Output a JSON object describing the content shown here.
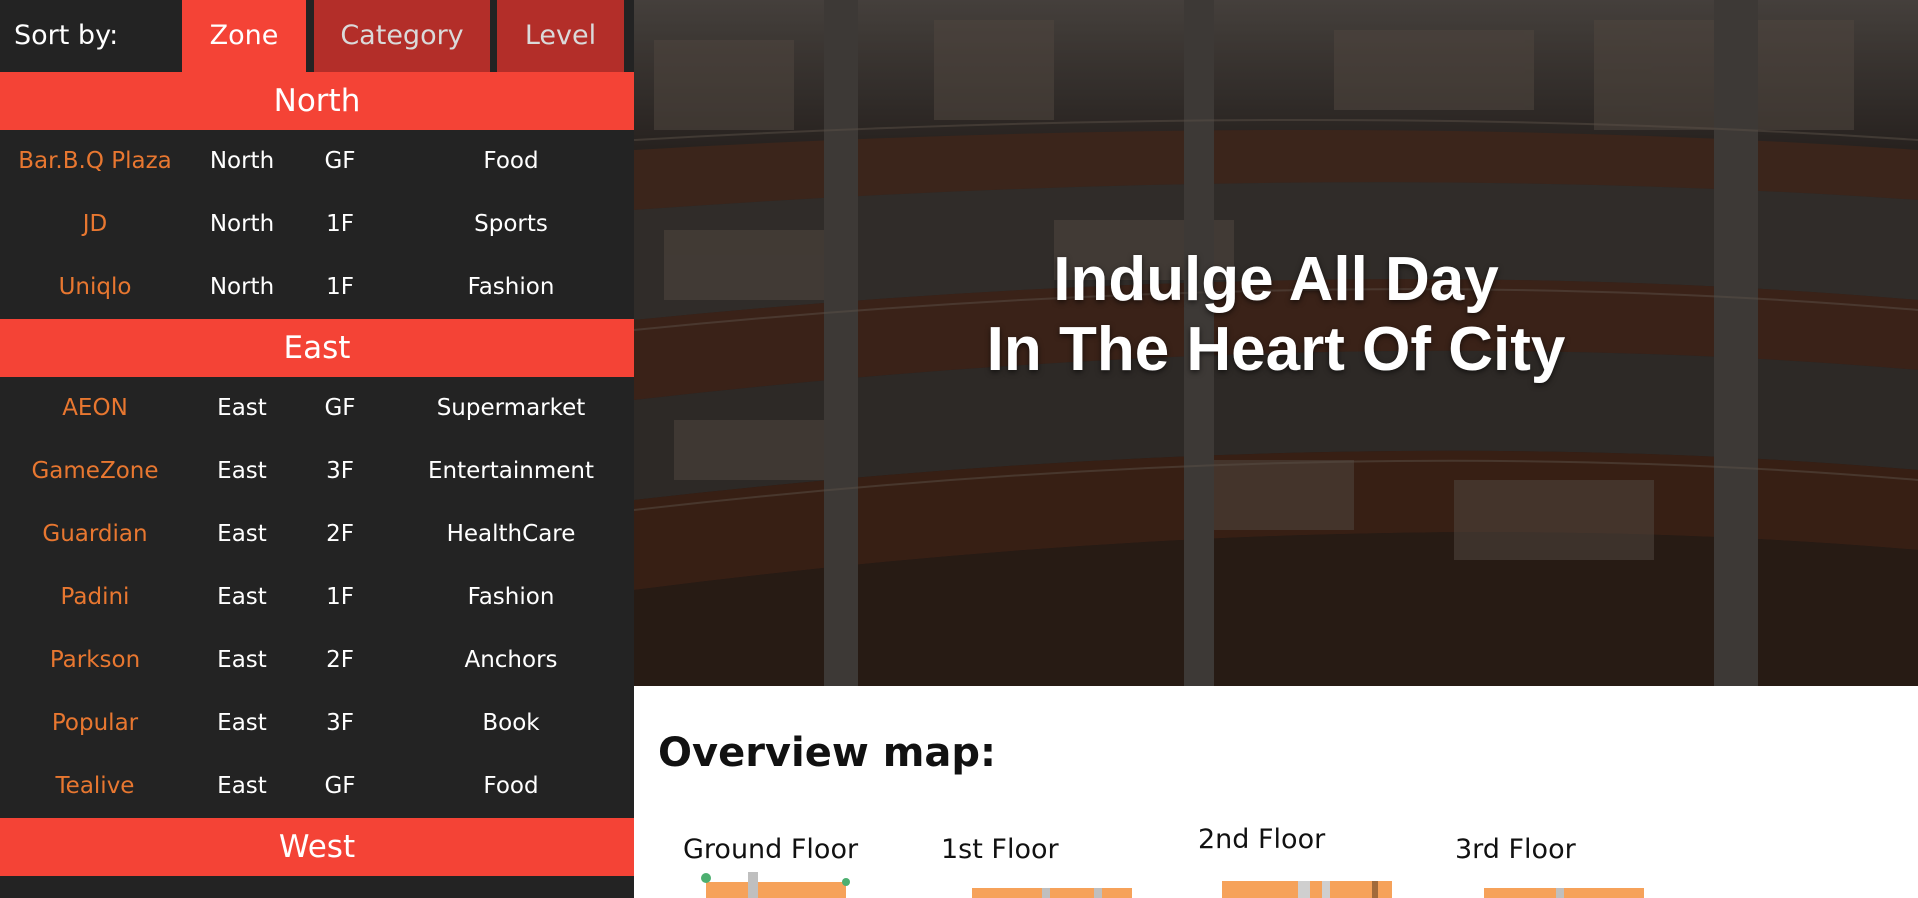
{
  "sort": {
    "label": "Sort by:",
    "tabs": [
      {
        "label": "Zone",
        "active": true
      },
      {
        "label": "Category",
        "active": false
      },
      {
        "label": "Level",
        "active": false
      }
    ]
  },
  "zones": [
    {
      "name": "North",
      "stores": [
        {
          "name": "Bar.B.Q Plaza",
          "zone": "North",
          "level": "GF",
          "category": "Food"
        },
        {
          "name": "JD",
          "zone": "North",
          "level": "1F",
          "category": "Sports"
        },
        {
          "name": "Uniqlo",
          "zone": "North",
          "level": "1F",
          "category": "Fashion"
        }
      ]
    },
    {
      "name": "East",
      "stores": [
        {
          "name": "AEON",
          "zone": "East",
          "level": "GF",
          "category": "Supermarket"
        },
        {
          "name": "GameZone",
          "zone": "East",
          "level": "3F",
          "category": "Entertainment"
        },
        {
          "name": "Guardian",
          "zone": "East",
          "level": "2F",
          "category": "HealthCare"
        },
        {
          "name": "Padini",
          "zone": "East",
          "level": "1F",
          "category": "Fashion"
        },
        {
          "name": "Parkson",
          "zone": "East",
          "level": "2F",
          "category": "Anchors"
        },
        {
          "name": "Popular",
          "zone": "East",
          "level": "3F",
          "category": "Book"
        },
        {
          "name": "Tealive",
          "zone": "East",
          "level": "GF",
          "category": "Food"
        }
      ]
    },
    {
      "name": "West",
      "stores": []
    }
  ],
  "hero": {
    "line1": "Indulge All Day",
    "line2": "In The Heart Of City"
  },
  "overview": {
    "title": "Overview map:",
    "floors": [
      "Ground Floor",
      "1st Floor",
      "2nd Floor",
      "3rd Floor"
    ]
  },
  "colors": {
    "accent": "#f44336",
    "accent_dark": "#b32e29",
    "sidebar_bg": "#232323",
    "store_name": "#e87730",
    "floorplan": "#f6a25a"
  }
}
